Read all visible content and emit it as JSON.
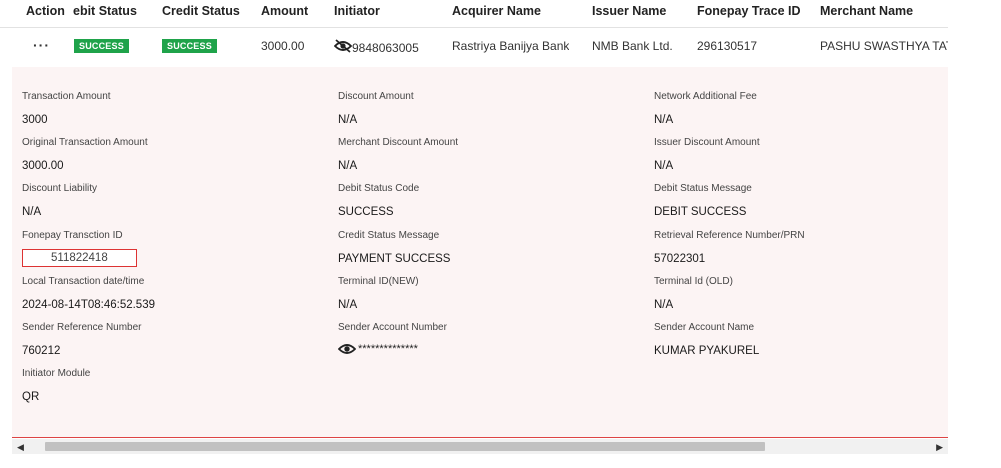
{
  "table": {
    "headers": {
      "action": "Action",
      "debit_status": "ebit Status",
      "credit_status": "Credit Status",
      "amount": "Amount",
      "initiator": "Initiator",
      "acquirer_name": "Acquirer Name",
      "issuer_name": "Issuer Name",
      "trace_id": "Fonepay Trace ID",
      "merchant_name": "Merchant Name"
    },
    "row": {
      "action": "···",
      "debit_status": "SUCCESS",
      "credit_status": "SUCCESS",
      "amount": "3000.00",
      "initiator": "9848063005",
      "acquirer_name": "Rastriya Banijya Bank",
      "issuer_name": "NMB Bank Ltd.",
      "trace_id": "296130517",
      "merchant_name": "PASHU SWASTHYA TATH"
    }
  },
  "details": {
    "transaction_amount": {
      "label": "Transaction Amount",
      "value": "3000"
    },
    "discount_amount": {
      "label": "Discount Amount",
      "value": "N/A"
    },
    "network_fee": {
      "label": "Network Additional Fee",
      "value": "N/A"
    },
    "original_amount": {
      "label": "Original Transaction Amount",
      "value": "3000.00"
    },
    "merchant_discount": {
      "label": "Merchant Discount Amount",
      "value": "N/A"
    },
    "issuer_discount": {
      "label": "Issuer Discount Amount",
      "value": "N/A"
    },
    "discount_liability": {
      "label": "Discount Liability",
      "value": "N/A"
    },
    "debit_status_code": {
      "label": "Debit Status Code",
      "value": "SUCCESS"
    },
    "debit_status_message": {
      "label": "Debit Status Message",
      "value": "DEBIT SUCCESS"
    },
    "fonepay_txn_id": {
      "label": "Fonepay Transction ID",
      "value": "511822418"
    },
    "credit_status_message": {
      "label": "Credit Status Message",
      "value": "PAYMENT SUCCESS"
    },
    "rrn": {
      "label": "Retrieval Reference Number/PRN",
      "value": "57022301"
    },
    "local_datetime": {
      "label": "Local Transaction date/time",
      "value": "2024-08-14T08:46:52.539"
    },
    "terminal_new": {
      "label": "Terminal ID(NEW)",
      "value": "N/A"
    },
    "terminal_old": {
      "label": "Terminal Id (OLD)",
      "value": "N/A"
    },
    "sender_ref": {
      "label": "Sender Reference Number",
      "value": "760212"
    },
    "sender_account_number": {
      "label": "Sender Account Number",
      "value": "**************"
    },
    "sender_account_name": {
      "label": "Sender Account Name",
      "value": "KUMAR PYAKUREL"
    },
    "initiator_module": {
      "label": "Initiator Module",
      "value": "QR"
    }
  },
  "colors": {
    "success_badge": "#1fa34a",
    "accent_red": "#dd4444",
    "panel_bg": "#fcf4f4"
  },
  "icons": {
    "initiator": "eye-slash-icon",
    "sender_account": "eye-icon"
  }
}
